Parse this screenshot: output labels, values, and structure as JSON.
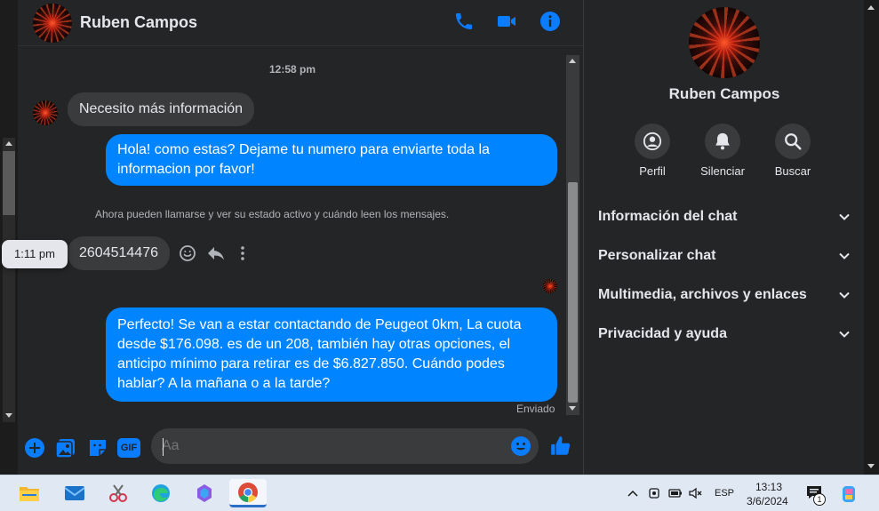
{
  "header": {
    "contact_name": "Ruben Campos",
    "icons": [
      "phone-icon",
      "video-camera-icon",
      "info-icon"
    ]
  },
  "messages": {
    "time_separator_1": "12:58 pm",
    "incoming_1": "Necesito más información",
    "outgoing_1": "Hola! como estas? Dejame tu numero para enviarte toda la informacion por favor!",
    "system_note": "Ahora pueden llamarse y ver su estado activo y cuándo leen los mensajes.",
    "tooltip_time": "1:11 pm",
    "incoming_2": "2604514476",
    "outgoing_2": "Perfecto!  Se van a estar contactando de Peugeot 0km, La cuota desde $176.098. es de un 208, también hay otras opciones, el anticipo mínimo para retirar es de $6.827.850. Cuándo podes hablar? A la mañana o a la tarde?",
    "sent_status": "Enviado"
  },
  "composer": {
    "placeholder": "Aa",
    "icons": [
      "plus-icon",
      "image-icon",
      "sticker-icon",
      "gif-icon",
      "emoji-icon",
      "like-icon"
    ],
    "gif_label": "GIF"
  },
  "profile": {
    "name": "Ruben Campos",
    "actions": [
      {
        "label": "Perfil",
        "icon": "profile-icon"
      },
      {
        "label": "Silenciar",
        "icon": "bell-icon"
      },
      {
        "label": "Buscar",
        "icon": "search-icon"
      }
    ],
    "sections": [
      {
        "label": "Información del chat"
      },
      {
        "label": "Personalizar chat"
      },
      {
        "label": "Multimedia, archivos y enlaces"
      },
      {
        "label": "Privacidad y ayuda"
      }
    ]
  },
  "taskbar": {
    "apps": [
      "file-explorer",
      "mail",
      "snipping-tool",
      "edge",
      "copilot",
      "chrome"
    ],
    "language": "ESP",
    "time": "13:13",
    "date": "3/6/2024",
    "notification_count": "1"
  },
  "colors": {
    "accent": "#0084ff",
    "background": "#242526",
    "bubble_incoming": "#3a3b3c"
  }
}
